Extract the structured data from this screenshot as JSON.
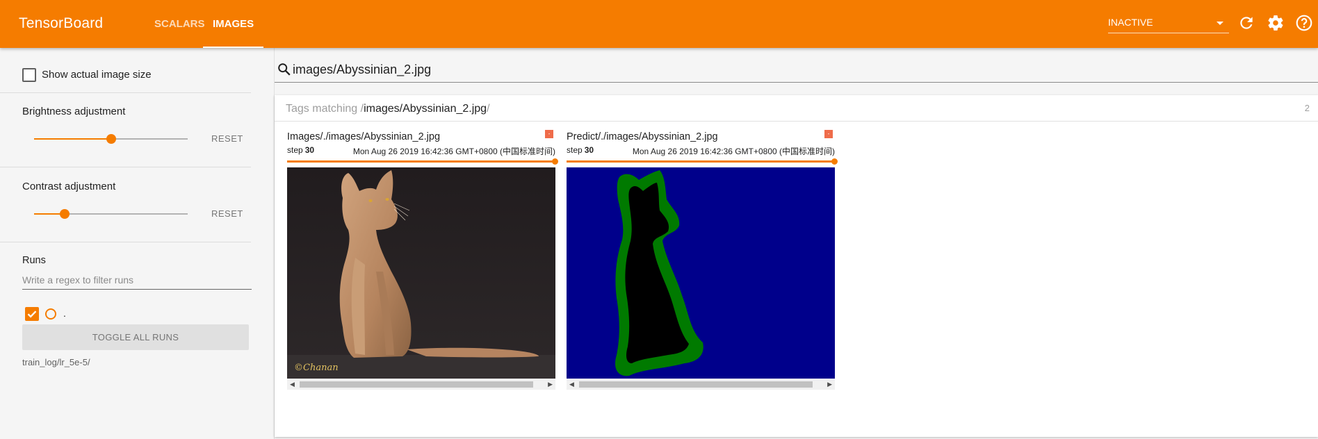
{
  "app": {
    "brand": "TensorBoard",
    "tabs": [
      {
        "label": "SCALARS",
        "active": false
      },
      {
        "label": "IMAGES",
        "active": true
      }
    ],
    "run_selector": "INACTIVE",
    "icons": [
      "refresh-icon",
      "settings-icon",
      "help-icon"
    ],
    "accent_color": "#f57c00"
  },
  "sidebar": {
    "show_actual_size": {
      "label": "Show actual image size",
      "checked": false
    },
    "brightness": {
      "label": "Brightness adjustment",
      "reset": "RESET",
      "level": 0.5
    },
    "contrast": {
      "label": "Contrast adjustment",
      "reset": "RESET",
      "level": 0.2
    },
    "runs": {
      "title": "Runs",
      "filter_placeholder": "Write a regex to filter runs",
      "items": [
        {
          "name": ".",
          "checked": true
        }
      ],
      "toggle_label": "TOGGLE ALL RUNS",
      "path": "train_log/lr_5e-5/"
    }
  },
  "main": {
    "search_value": "images/Abyssinian_2.jpg",
    "card": {
      "prefix": "Tags matching /",
      "query": "images/Abyssinian_2.jpg",
      "suffix": "/",
      "count": "2"
    },
    "panes": [
      {
        "title": "Images/./images/Abyssinian_2.jpg",
        "step_label": "step",
        "step": "30",
        "time": "Mon Aug 26 2019 16:42:36 GMT+0800 (中国标准时间)",
        "tag": "-",
        "step_progress": 1.0,
        "image": "abyssinian-cat-photo"
      },
      {
        "title": "Predict/./images/Abyssinian_2.jpg",
        "step_label": "step",
        "step": "30",
        "time": "Mon Aug 26 2019 16:42:36 GMT+0800 (中国标准时间)",
        "tag": "-",
        "step_progress": 1.0,
        "image": "segmentation-mask"
      }
    ]
  }
}
